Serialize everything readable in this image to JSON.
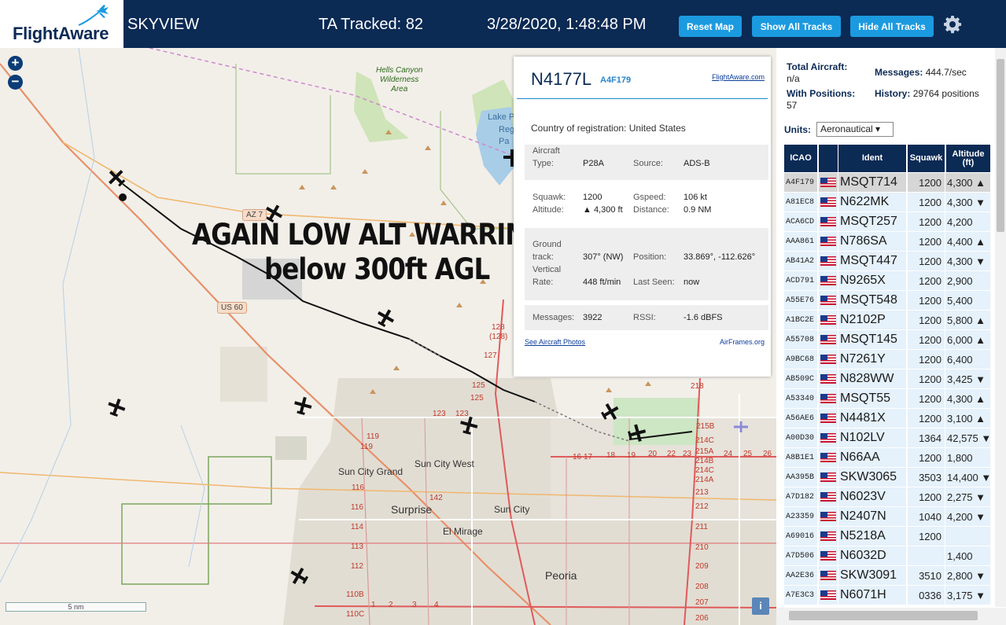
{
  "header": {
    "logo_text": "FlightAware",
    "app_name": "SKYVIEW",
    "tracked_label": "TA Tracked: 82",
    "datetime": "3/28/2020, 1:48:48 PM",
    "buttons": {
      "reset": "Reset Map",
      "show_all": "Show All Tracks",
      "hide_all": "Hide All Tracks"
    },
    "settings_icon": "gear-icon",
    "colors": {
      "header_bg": "#0b2a54",
      "button_bg": "#1b9ae0"
    }
  },
  "map": {
    "zoom_in": "+",
    "zoom_out": "−",
    "overlay_line1": "AGAIN LOW ALT WARRING",
    "overlay_line2": "below 300ft AGL",
    "scale": "5 nm",
    "attribution_btn": "i",
    "labels": {
      "hells_canyon": "Hells Canyon\nWilderness\nArea",
      "lake_pl": "Lake P",
      "lake_reg": "Reg",
      "lake_pa": "Pa",
      "sun_city_grand": "Sun City Grand",
      "sun_city_west": "Sun City West",
      "sun_city": "Sun City",
      "surprise": "Surprise",
      "el_mirage": "El Mirage",
      "peoria": "Peoria"
    },
    "shields": {
      "az74": "AZ 7",
      "us60": "US 60"
    },
    "road_numbers": [
      "128",
      "(128)",
      "127",
      "125",
      "125",
      "123",
      "123",
      "119",
      "119",
      "116",
      "116",
      "114",
      "113",
      "112",
      "110B",
      "110C",
      "142",
      "218",
      "215B",
      "214C",
      "215A",
      "214B",
      "214C",
      "214A",
      "213",
      "212",
      "211",
      "210",
      "209",
      "208",
      "207",
      "206",
      "17",
      "16",
      "18",
      "19",
      "20",
      "22",
      "23",
      "24",
      "25",
      "26",
      "1",
      "2",
      "3",
      "4"
    ]
  },
  "popup": {
    "registration": "N4177L",
    "icao": "A4F179",
    "fa_link": "FlightAware.com",
    "country_label": "Country of registration:",
    "country_value": "United States",
    "aircraft_type_label": "Aircraft Type:",
    "aircraft_type_value": "P28A",
    "source_label": "Source:",
    "source_value": "ADS-B",
    "squawk_label": "Squawk:",
    "squawk_value": "1200",
    "gspeed_label": "Gspeed:",
    "gspeed_value": "106 kt",
    "altitude_label": "Altitude:",
    "altitude_value": "▲ 4,300 ft",
    "distance_label": "Distance:",
    "distance_value": "0.9 NM",
    "ground_track_label": "Ground track:",
    "ground_track_value": "307° (NW)",
    "position_label": "Position:",
    "position_value": "33.869°, -112.626°",
    "vertical_rate_label": "Vertical Rate:",
    "vertical_rate_value": "448 ft/min",
    "last_seen_label": "Last Seen:",
    "last_seen_value": "now",
    "messages_label": "Messages:",
    "messages_value": "3922",
    "rssi_label": "RSSI:",
    "rssi_value": "-1.6 dBFS",
    "photos_link": "See Aircraft Photos",
    "airframes_link": "AirFrames.org"
  },
  "stats": {
    "total_aircraft_label": "Total Aircraft:",
    "total_aircraft_value": "n/a",
    "with_positions_label": "With Positions:",
    "with_positions_value": "57",
    "messages_label": "Messages:",
    "messages_value": "444.7/sec",
    "history_label": "History:",
    "history_value": "29764 positions"
  },
  "units": {
    "label": "Units:",
    "selected": "Aeronautical ▾"
  },
  "table": {
    "headers": [
      "ICAO",
      "",
      "Ident",
      "Squawk",
      "Altitude (ft)"
    ],
    "rows": [
      {
        "icao": "A4F179",
        "ident": "MSQT714",
        "squawk": "1200",
        "alt": "4,300 ▲",
        "selected": true
      },
      {
        "icao": "A81EC8",
        "ident": "N622MK",
        "squawk": "1200",
        "alt": "4,300 ▼"
      },
      {
        "icao": "ACA6CD",
        "ident": "MSQT257",
        "squawk": "1200",
        "alt": "4,200"
      },
      {
        "icao": "AAA861",
        "ident": "N786SA",
        "squawk": "1200",
        "alt": "4,400 ▲"
      },
      {
        "icao": "AB41A2",
        "ident": "MSQT447",
        "squawk": "1200",
        "alt": "4,300 ▼"
      },
      {
        "icao": "ACD791",
        "ident": "N9265X",
        "squawk": "1200",
        "alt": "2,900"
      },
      {
        "icao": "A55E76",
        "ident": "MSQT548",
        "squawk": "1200",
        "alt": "5,400"
      },
      {
        "icao": "A1BC2E",
        "ident": "N2102P",
        "squawk": "1200",
        "alt": "5,800 ▲"
      },
      {
        "icao": "A55708",
        "ident": "MSQT145",
        "squawk": "1200",
        "alt": "6,000 ▲"
      },
      {
        "icao": "A9BC68",
        "ident": "N7261Y",
        "squawk": "1200",
        "alt": "6,400"
      },
      {
        "icao": "AB509C",
        "ident": "N828WW",
        "squawk": "1200",
        "alt": "3,425 ▼"
      },
      {
        "icao": "A53340",
        "ident": "MSQT55",
        "squawk": "1200",
        "alt": "4,300 ▲"
      },
      {
        "icao": "A56AE6",
        "ident": "N4481X",
        "squawk": "1200",
        "alt": "3,100 ▲"
      },
      {
        "icao": "A00D30",
        "ident": "N102LV",
        "squawk": "1364",
        "alt": "42,575 ▼"
      },
      {
        "icao": "A8B1E1",
        "ident": "N66AA",
        "squawk": "1200",
        "alt": "1,800"
      },
      {
        "icao": "AA395B",
        "ident": "SKW3065",
        "squawk": "3503",
        "alt": "14,400 ▼"
      },
      {
        "icao": "A7D182",
        "ident": "N6023V",
        "squawk": "1200",
        "alt": "2,275 ▼"
      },
      {
        "icao": "A23359",
        "ident": "N2407N",
        "squawk": "1040",
        "alt": "4,200 ▼"
      },
      {
        "icao": "A69016",
        "ident": "N5218A",
        "squawk": "1200",
        "alt": ""
      },
      {
        "icao": "A7D506",
        "ident": "N6032D",
        "squawk": "",
        "alt": "1,400"
      },
      {
        "icao": "AA2E36",
        "ident": "SKW3091",
        "squawk": "3510",
        "alt": "2,800 ▼"
      },
      {
        "icao": "A7E3C3",
        "ident": "N6071H",
        "squawk": "0336",
        "alt": "3,175 ▼"
      }
    ],
    "colors": {
      "header_bg": "#0b2a54",
      "row_bg": "#e5f1fb",
      "selected_bg": "#d6d6d6"
    }
  }
}
